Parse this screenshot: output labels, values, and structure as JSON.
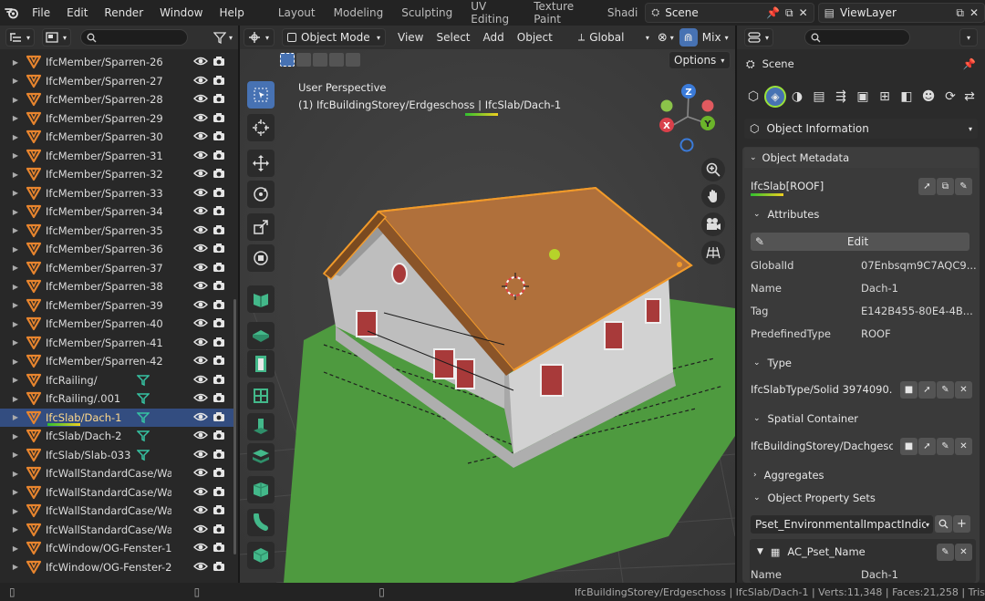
{
  "topbar": {
    "menus": [
      "File",
      "Edit",
      "Render",
      "Window",
      "Help"
    ],
    "workspaces": [
      "Layout",
      "Modeling",
      "Sculpting",
      "UV Editing",
      "Texture Paint",
      "Shadi"
    ],
    "scene": "Scene",
    "view_layer": "ViewLayer"
  },
  "outliner": {
    "rows": [
      {
        "label": "IfcMember/Sparren-26"
      },
      {
        "label": "IfcMember/Sparren-27"
      },
      {
        "label": "IfcMember/Sparren-28"
      },
      {
        "label": "IfcMember/Sparren-29"
      },
      {
        "label": "IfcMember/Sparren-30"
      },
      {
        "label": "IfcMember/Sparren-31"
      },
      {
        "label": "IfcMember/Sparren-32"
      },
      {
        "label": "IfcMember/Sparren-33"
      },
      {
        "label": "IfcMember/Sparren-34"
      },
      {
        "label": "IfcMember/Sparren-35"
      },
      {
        "label": "IfcMember/Sparren-36"
      },
      {
        "label": "IfcMember/Sparren-37"
      },
      {
        "label": "IfcMember/Sparren-38"
      },
      {
        "label": "IfcMember/Sparren-39"
      },
      {
        "label": "IfcMember/Sparren-40"
      },
      {
        "label": "IfcMember/Sparren-41"
      },
      {
        "label": "IfcMember/Sparren-42"
      },
      {
        "label": "IfcRailing/",
        "filter": true
      },
      {
        "label": "IfcRailing/.001",
        "filter": true
      },
      {
        "label": "IfcSlab/Dach-1",
        "filter": true,
        "selected": true
      },
      {
        "label": "IfcSlab/Dach-2",
        "filter": true
      },
      {
        "label": "IfcSlab/Slab-033",
        "filter": true
      },
      {
        "label": "IfcWallStandardCase/Wan"
      },
      {
        "label": "IfcWallStandardCase/Wan"
      },
      {
        "label": "IfcWallStandardCase/Wan"
      },
      {
        "label": "IfcWallStandardCase/Wan"
      },
      {
        "label": "IfcWindow/OG-Fenster-1"
      },
      {
        "label": "IfcWindow/OG-Fenster-2"
      }
    ]
  },
  "viewport": {
    "mode": "Object Mode",
    "menus": [
      "View",
      "Select",
      "Add",
      "Object"
    ],
    "orientation": "Global",
    "shading": "Mix",
    "options": "Options",
    "perspective": "User Perspective",
    "object_path": "(1) IfcBuildingStorey/Erdgeschoss | IfcSlab/Dach-1",
    "gizmo": {
      "z": "Z",
      "y": "Y",
      "x": "X"
    }
  },
  "properties": {
    "scene": "Scene",
    "tab": "Object Information",
    "object_metadata": "Object Metadata",
    "object_name": "IfcSlab[ROOF]",
    "attributes": "Attributes",
    "edit": "Edit",
    "fields": [
      {
        "key": "GlobalId",
        "value": "07Enbsqm9C7AQC9..."
      },
      {
        "key": "Name",
        "value": "Dach-1"
      },
      {
        "key": "Tag",
        "value": "E142B455-80E4-4B..."
      },
      {
        "key": "PredefinedType",
        "value": "ROOF"
      }
    ],
    "type_header": "Type",
    "type_value": "IfcSlabType/Solid 3974090...",
    "spatial_header": "Spatial Container",
    "spatial_value": "IfcBuildingStorey/Dachgesc...",
    "aggregates": "Aggregates",
    "pset_header": "Object Property Sets",
    "pset_select": "Pset_EnvironmentalImpactIndic...",
    "ac_pset": "AC_Pset_Name",
    "ac_field": {
      "key": "Name",
      "value": "Dach-1"
    }
  },
  "status": {
    "text": "IfcBuildingStorey/Erdgeschoss | IfcSlab/Dach-1 | Verts:11,348 | Faces:21,258 | Tris"
  },
  "colors": {
    "accent": "#4772b3",
    "roof": "#b0703b",
    "selection": "#f19a2a",
    "ground": "#4e9a3f"
  }
}
